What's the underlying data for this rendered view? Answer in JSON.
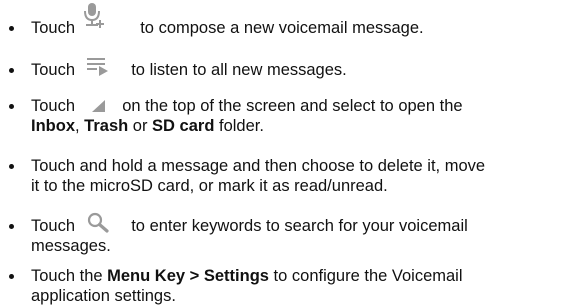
{
  "items": [
    {
      "pre": "Touch",
      "icon": "voicemail-compose-icon",
      "post": "to compose a new voicemail message."
    },
    {
      "pre": "Touch",
      "icon": "play-all-icon",
      "post": "to listen to all new messages."
    },
    {
      "pre": "Touch",
      "icon": "folder-dropdown-icon",
      "post": "on the top of the screen and select to open the",
      "line2_bold1": "Inbox",
      "line2_sep1": ", ",
      "line2_bold2": "Trash",
      "line2_sep2": " or ",
      "line2_bold3": "SD card",
      "line2_tail": " folder."
    },
    {
      "line1": "Touch and hold a message and then choose to delete it, move",
      "line2": "it to the microSD card, or mark it as read/unread."
    },
    {
      "pre": "Touch",
      "icon": "search-icon",
      "post": "to enter keywords to search for your voicemail",
      "line2": "messages."
    },
    {
      "pre": "Touch the ",
      "bold": "Menu Key > Settings",
      "post": " to configure the Voicemail",
      "line2": "application settings."
    }
  ],
  "colors": {
    "text": "#111111",
    "icon": "#9a9a9a"
  }
}
